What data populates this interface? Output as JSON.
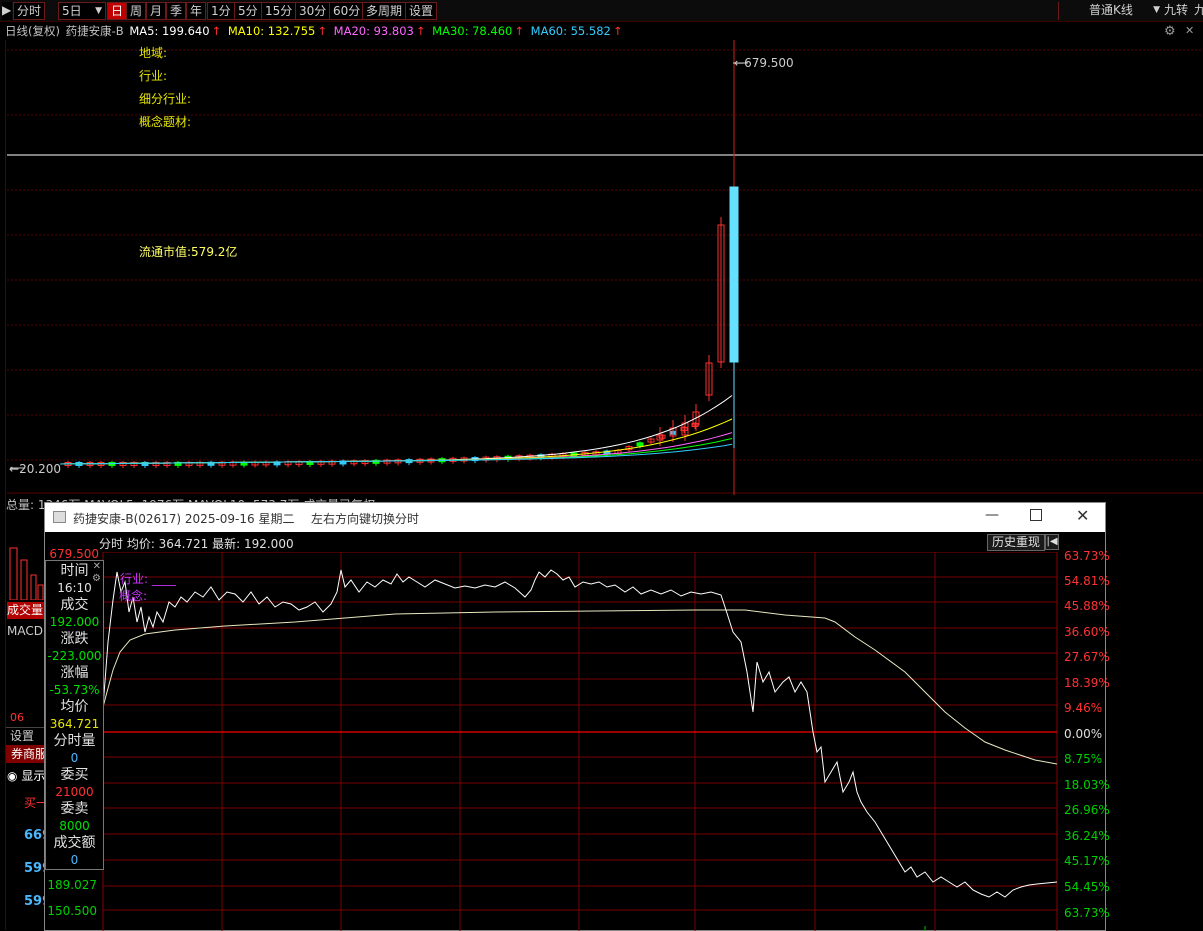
{
  "toolbar": {
    "buttons": [
      "分时",
      "5日",
      "日",
      "周",
      "月",
      "季",
      "年",
      "1分",
      "5分",
      "15分",
      "30分",
      "60分",
      "多周期",
      "设置"
    ],
    "active": "日",
    "chart_type": "普通K线",
    "right_label": "九转",
    "right_label2": "九"
  },
  "ma_header": {
    "prefix": "日线(复权)",
    "name": "药捷安康-B",
    "ma5": "MA5: 199.640",
    "ma10": "MA10: 132.755",
    "ma20": "MA20: 93.803",
    "ma30": "MA30: 78.460",
    "ma60": "MA60: 55.582",
    "arrow": "↑",
    "colors": {
      "ma5": "#ffffff",
      "ma10": "#ffff00",
      "ma20": "#ff66ff",
      "ma30": "#00ff00",
      "ma60": "#33ccff"
    }
  },
  "info_labels": {
    "region": "地域:",
    "industry": "行业:",
    "sub_industry": "细分行业:",
    "concept": "概念题材:",
    "float_cap": "流通市值:579.2亿"
  },
  "kline": {
    "high_label": "679.500",
    "low_label": "20.200"
  },
  "volume_bar": {
    "text": "总量: 1346万 MAVOL5: 1976万 MAVOL10: 573.7万 成交量已复权"
  },
  "left_panel": {
    "chengjiao": "成交量",
    "macd": "MACD",
    "date_num": "06",
    "settings": "设置",
    "broker": "券商服",
    "show": "显示",
    "buy": "买一",
    "prices": [
      "669",
      "599",
      "599"
    ]
  },
  "popup": {
    "title": "药捷安康-B(02617) 2025-09-16 星期二",
    "hint": "左右方向键切换分时",
    "header": "分时 均价: 364.721 最新: 192.000",
    "history_button": "历史重现",
    "overlay_industry": "行业:",
    "overlay_concept": "概念:",
    "left_axis": [
      "679.500",
      "189.027",
      "150.500"
    ],
    "right_axis": [
      "63.73%",
      "54.81%",
      "45.88%",
      "36.60%",
      "27.67%",
      "18.39%",
      "9.46%",
      "0.00%",
      "8.75%",
      "18.03%",
      "26.96%",
      "36.24%",
      "45.17%",
      "54.45%",
      "63.73%"
    ],
    "info_box": {
      "time_label": "时间",
      "time_value": "16:10",
      "deal_label": "成交",
      "deal_value": "192.000",
      "change_label": "涨跌",
      "change_value": "-223.000",
      "pct_label": "涨幅",
      "pct_value": "-53.73%",
      "avg_label": "均价",
      "avg_value": "364.721",
      "vol_label": "分时量",
      "vol_value": "0",
      "buy_label": "委买",
      "buy_value": "21000",
      "sell_label": "委卖",
      "sell_value": "8000",
      "amount_label": "成交额",
      "amount_value": "0"
    }
  }
}
